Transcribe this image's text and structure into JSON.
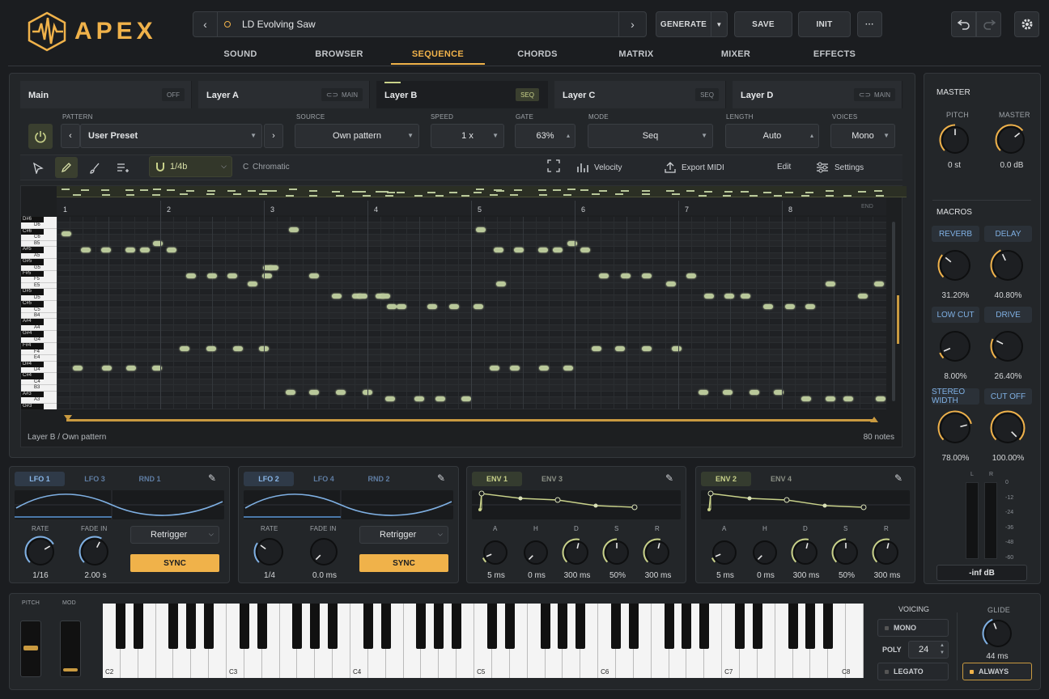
{
  "brand": {
    "name": "APEX",
    "accent": "#f0b24a"
  },
  "preset": {
    "name": "LD Evolving Saw",
    "prev_icon": "chevron-left",
    "next_icon": "chevron-right"
  },
  "header": {
    "generate": "GENERATE",
    "save": "SAVE",
    "init": "INIT",
    "more": "···"
  },
  "nav_tabs": [
    "SOUND",
    "BROWSER",
    "SEQUENCE",
    "CHORDS",
    "MATRIX",
    "MIXER",
    "EFFECTS"
  ],
  "layers": [
    {
      "name": "Main",
      "badge": "OFF"
    },
    {
      "name": "Layer A",
      "badge": "MAIN"
    },
    {
      "name": "Layer B",
      "badge": "SEQ"
    },
    {
      "name": "Layer C",
      "badge": "SEQ"
    },
    {
      "name": "Layer D",
      "badge": "MAIN"
    }
  ],
  "controls": {
    "pattern_label": "PATTERN",
    "pattern_value": "User Preset",
    "source_label": "SOURCE",
    "source_value": "Own pattern",
    "speed_label": "SPEED",
    "speed_value": "1 x",
    "gate_label": "GATE",
    "gate_value": "63%",
    "mode_label": "MODE",
    "mode_value": "Seq",
    "length_label": "LENGTH",
    "length_value": "Auto",
    "voices_label": "VOICES",
    "voices_value": "Mono"
  },
  "toolbar": {
    "grid": "1/4b",
    "scale_root": "C",
    "scale": "Chromatic",
    "velocity": "Velocity",
    "export": "Export MIDI",
    "edit": "Edit",
    "settings": "Settings"
  },
  "roll": {
    "bars": [
      "1",
      "2",
      "3",
      "4",
      "5",
      "6",
      "7",
      "8"
    ],
    "end_label": "END",
    "keys": [
      "D#6",
      "D6",
      "C#6",
      "C6",
      "B5",
      "A#5",
      "A5",
      "G#5",
      "G5",
      "F#5",
      "F5",
      "E5",
      "D#5",
      "D5",
      "C#5",
      "C5",
      "B4",
      "A#4",
      "A4",
      "G#4",
      "G4",
      "F#4",
      "F4",
      "E4",
      "D#4",
      "D4",
      "C#4",
      "C4",
      "B3",
      "A#3",
      "A3",
      "G#3"
    ],
    "footer_left": "Layer B / Own pattern",
    "footer_right": "80 notes"
  },
  "master": {
    "title": "MASTER",
    "pitch_label": "PITCH",
    "pitch_value": "0 st",
    "master_label": "MASTER",
    "master_value": "0.0 dB"
  },
  "macros": {
    "title": "MACROS",
    "items": [
      {
        "name": "REVERB",
        "value": "31.20%",
        "level": 0.312
      },
      {
        "name": "DELAY",
        "value": "40.80%",
        "level": 0.408
      },
      {
        "name": "LOW CUT",
        "value": "8.00%",
        "level": 0.08
      },
      {
        "name": "DRIVE",
        "value": "26.40%",
        "level": 0.264
      },
      {
        "name": "STEREO WIDTH",
        "value": "78.00%",
        "level": 0.78
      },
      {
        "name": "CUT OFF",
        "value": "100.00%",
        "level": 1.0
      }
    ]
  },
  "meter": {
    "left": "L",
    "right": "R",
    "scale": [
      "0",
      "-12",
      "-24",
      "-36",
      "-48",
      "-60"
    ],
    "readout": "-inf dB"
  },
  "lfo1": {
    "tabs": [
      "LFO 1",
      "LFO 3",
      "RND 1"
    ],
    "rate_label": "RATE",
    "rate_value": "1/16",
    "fade_label": "FADE IN",
    "fade_value": "2.00 s",
    "mode": "Retrigger",
    "sync": "SYNC"
  },
  "lfo2": {
    "tabs": [
      "LFO 2",
      "LFO 4",
      "RND 2"
    ],
    "rate_label": "RATE",
    "rate_value": "1/4",
    "fade_label": "FADE IN",
    "fade_value": "0.0 ms",
    "mode": "Retrigger",
    "sync": "SYNC"
  },
  "env1": {
    "tabs": [
      "ENV 1",
      "ENV 3"
    ],
    "labels": [
      "A",
      "H",
      "D",
      "S",
      "R"
    ],
    "values": [
      "5 ms",
      "0 ms",
      "300 ms",
      "50%",
      "300 ms"
    ]
  },
  "env2": {
    "tabs": [
      "ENV 2",
      "ENV 4"
    ],
    "labels": [
      "A",
      "H",
      "D",
      "S",
      "R"
    ],
    "values": [
      "5 ms",
      "0 ms",
      "300 ms",
      "50%",
      "300 ms"
    ]
  },
  "keyboard": {
    "pitch_label": "PITCH",
    "mod_label": "MOD",
    "octaves": [
      "C2",
      "C3",
      "C4",
      "C5",
      "C6",
      "C7",
      "C8"
    ]
  },
  "voicing": {
    "title": "VOICING",
    "mono": "MONO",
    "poly_label": "POLY",
    "poly_value": "24",
    "legato": "LEGATO",
    "glide_label": "GLIDE",
    "glide_value": "44 ms",
    "always": "ALWAYS"
  }
}
